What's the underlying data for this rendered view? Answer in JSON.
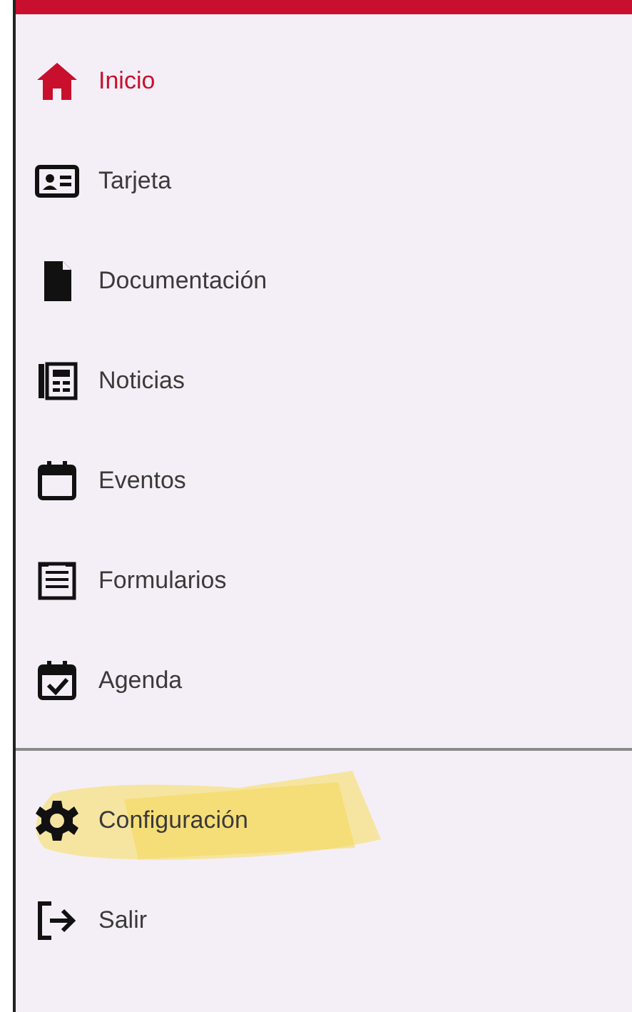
{
  "menu": {
    "items": [
      {
        "label": "Inicio",
        "selected": true
      },
      {
        "label": "Tarjeta",
        "selected": false
      },
      {
        "label": "Documentación",
        "selected": false
      },
      {
        "label": "Noticias",
        "selected": false
      },
      {
        "label": "Eventos",
        "selected": false
      },
      {
        "label": "Formularios",
        "selected": false
      },
      {
        "label": "Agenda",
        "selected": false
      }
    ]
  },
  "footer_menu": {
    "items": [
      {
        "label": "Configuración",
        "selected": false,
        "highlighted": true
      },
      {
        "label": "Salir",
        "selected": false,
        "highlighted": false
      }
    ]
  }
}
